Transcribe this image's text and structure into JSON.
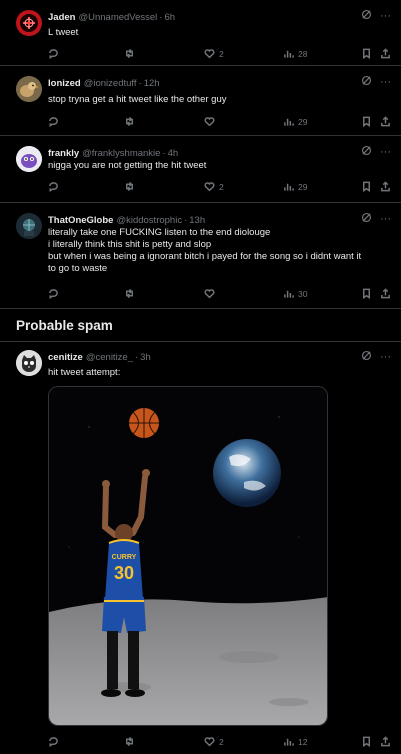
{
  "tweets": [
    {
      "name": "Jaden",
      "handle": "@UnnamedVessel",
      "time": "6h",
      "text": [
        "L tweet"
      ],
      "replies": "",
      "retweets": "",
      "likes": "2",
      "views": "28",
      "avatar": "red-badge-avatar"
    },
    {
      "name": "Ionized",
      "handle": "@ionizedtuff",
      "time": "12h",
      "text": [
        "stop tryna get a hit tweet like the other guy"
      ],
      "replies": "",
      "retweets": "",
      "likes": "",
      "views": "29",
      "avatar": "bird-avatar"
    },
    {
      "name": "frankly",
      "handle": "@franklyshmankie",
      "time": "4h",
      "text": [
        "nigga you are not getting the hit tweet"
      ],
      "replies": "",
      "retweets": "",
      "likes": "2",
      "views": "29",
      "avatar": "purple-character-avatar"
    },
    {
      "name": "ThatOneGlobe",
      "handle": "@kiddostrophic",
      "time": "13h",
      "text": [
        "literally take one FUCKING listen to the end diolouge",
        "i literally think this shit is petty and slop",
        "but when i was being a ignorant bitch i payed for the song so i didnt want it",
        "to go to waste"
      ],
      "replies": "",
      "retweets": "",
      "likes": "",
      "views": "30",
      "avatar": "globe-avatar"
    }
  ],
  "section": {
    "title": "Probable spam"
  },
  "spam_tweet": {
    "name": "cenitize",
    "handle": "@cenitize_",
    "time": "3h",
    "text": [
      "hit tweet attempt:"
    ],
    "replies": "",
    "retweets": "",
    "likes": "2",
    "views": "12",
    "avatar": "cat-avatar",
    "image": {
      "jersey_name": "CURRY",
      "jersey_number": "30",
      "description_icon": "basketball-moon-image"
    }
  },
  "colors": {
    "background": "#000000",
    "text": "#e7e9ea",
    "muted": "#71767b",
    "border": "#2f3336",
    "jersey": "#1d4fa8",
    "jersey_accent": "#f7c22d"
  }
}
